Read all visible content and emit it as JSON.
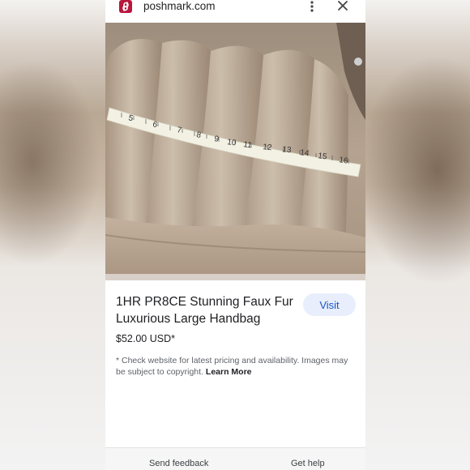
{
  "browser": {
    "domain": "poshmark.com",
    "site_icon": "poshmark-logo-icon",
    "menu_icon": "more-vert-icon",
    "close_icon": "close-icon"
  },
  "product": {
    "image_label": "Faux fur handbag with tape measure",
    "tape_numbers": [
      "5",
      "6",
      "7",
      "8",
      "9",
      "10",
      "11",
      "12",
      "13",
      "14",
      "15",
      "16"
    ],
    "title": "1HR PR8CE Stunning Faux Fur Luxurious Large Handbag",
    "price": "$52.00 USD*",
    "visit_label": "Visit"
  },
  "disclaimer": {
    "text": "* Check website for latest pricing and availability. Images may be subject to copyright. ",
    "learn_more": "Learn More"
  },
  "footer": {
    "send_feedback": "Send feedback",
    "get_help": "Get help"
  },
  "colors": {
    "brand": "#b8163b",
    "visit_bg": "#e8eefb",
    "visit_text": "#1a56c8"
  }
}
